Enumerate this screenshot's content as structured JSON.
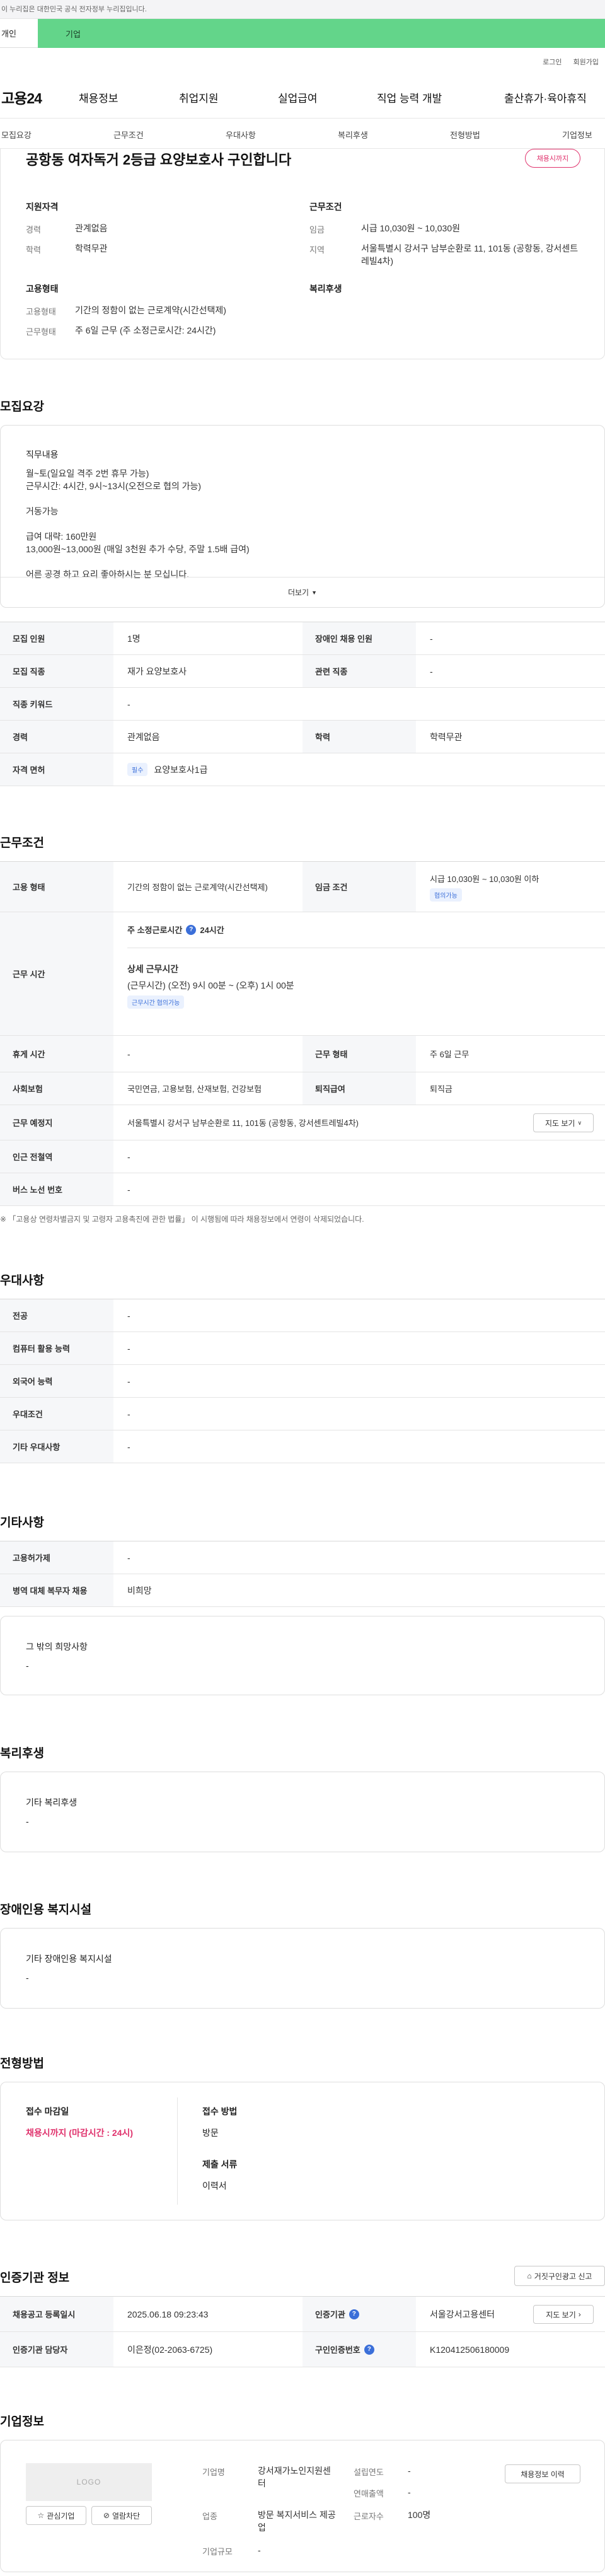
{
  "gov_notice": "이 누리집은 대한민국 공식 전자정부 누리집입니다.",
  "top_tabs": [
    "개인",
    "기업"
  ],
  "util_links": [
    "로그인",
    "회원가입"
  ],
  "logo": "고용24",
  "gnb": [
    "채용정보",
    "취업지원",
    "실업급여",
    "직업 능력 개발",
    "출산휴가·육아휴직"
  ],
  "subnav": [
    "모집요강",
    "근무조건",
    "우대사항",
    "복리후생",
    "전형방법",
    "기업정보"
  ],
  "header": {
    "title": "공항동 여자독거 2등급 요양보호사 구인합니다",
    "badge": "채용시까지",
    "qual_label": "지원자격",
    "career_k": "경력",
    "career_v": "관계없음",
    "edu_k": "학력",
    "edu_v": "학력무관",
    "cond_label": "근무조건",
    "wage_k": "임금",
    "wage_v": "시급 10,030원 ~ 10,030원",
    "region_k": "지역",
    "region_v": "서울특별시 강서구 남부순환로 11, 101동 (공항동, 강서센트레빌4차)",
    "emp_label": "고용형태",
    "emptype_k": "고용형태",
    "emptype_v": "기간의 정함이 없는 근로계약(시간선택제)",
    "worktype_k": "근무형태",
    "worktype_v": "주 6일 근무 (주 소정근로시간: 24시간)",
    "welfare_label": "복리후생"
  },
  "recruit": {
    "title": "모집요강",
    "duty_label": "직무내용",
    "lines": [
      "월~토(일요일 격주 2번 휴무 가능)",
      "근무시간: 4시간, 9시~13시(오전으로 협의 가능)",
      "",
      "거동가능",
      "",
      "급여 대략: 160만원",
      "13,000원~13,000원 (매일 3천원 추가 수당, 주말 1.5배 급여)",
      "",
      "어른 공경 하고 요리 좋아하시는 분 모십니다."
    ],
    "more": "더보기",
    "rows": [
      {
        "k1": "모집 인원",
        "v1": "1명",
        "k2": "장애인 채용 인원",
        "v2": "-"
      },
      {
        "k1": "모집 직종",
        "v1": "재가 요양보호사",
        "k2": "관련 직종",
        "v2": "-"
      },
      {
        "k1": "직종 키워드",
        "v1": "-"
      },
      {
        "k1": "경력",
        "v1": "관계없음",
        "k2": "학력",
        "v2": "학력무관"
      }
    ],
    "license_k": "자격 면허",
    "license_tag": "필수",
    "license_v": "요양보호사1급"
  },
  "work": {
    "title": "근무조건",
    "emptype_k": "고용 형태",
    "emptype_v": "기간의 정함이 없는 근로계약(시간선택제)",
    "wage_k": "임금 조건",
    "wage_v": "시급 10,030원 ~ 10,030원 이하",
    "wage_tag": "협의가능",
    "hours_k": "근무 시간",
    "hours_weekly": "주 소정근로시간",
    "hours_weekly_v": "24시간",
    "hours_detail_label": "상세 근무시간",
    "hours_detail_v": "(근무시간) (오전) 9시 00분 ~ (오후) 1시 00분",
    "hours_tag": "근무시간 협의가능",
    "break_k": "휴게 시간",
    "break_v": "-",
    "form_k": "근무 형태",
    "form_v": "주 6일 근무",
    "ins_k": "사회보험",
    "ins_v": "국민연금, 고용보험, 산재보험, 건강보험",
    "sev_k": "퇴직급여",
    "sev_v": "퇴직금",
    "place_k": "근무 예정지",
    "place_v": "서울특별시 강서구 남부순환로 11, 101동 (공항동, 강서센트레빌4차)",
    "map_btn": "지도 보기",
    "subway_k": "인근 전철역",
    "subway_v": "-",
    "bus_k": "버스 노선 번호",
    "bus_v": "-",
    "note": "※ 「고용상 연령차별금지 및 고령자 고용촉진에 관한 법률」 이 시행됨에 따라 채용정보에서 연령이 삭제되었습니다."
  },
  "pref": {
    "title": "우대사항",
    "rows": [
      {
        "k": "전공",
        "v": "-"
      },
      {
        "k": "컴퓨터 활용 능력",
        "v": "-"
      },
      {
        "k": "외국어 능력",
        "v": "-"
      },
      {
        "k": "우대조건",
        "v": "-"
      },
      {
        "k": "기타 우대사항",
        "v": "-"
      }
    ]
  },
  "etc": {
    "title": "기타사항",
    "rows": [
      {
        "k": "고용허가제",
        "v": "-"
      },
      {
        "k": "병역 대체 복무자 채용",
        "v": "비희망"
      }
    ],
    "other_label": "그 밖의 희망사항",
    "other_v": "-"
  },
  "welfare": {
    "title": "복리후생",
    "label": "기타 복리후생",
    "v": "-"
  },
  "disability": {
    "title": "장애인용 복지시설",
    "label": "기타 장애인용 복지시설",
    "v": "-"
  },
  "process": {
    "title": "전형방법",
    "deadline_label": "접수 마감일",
    "deadline_v": "채용시까지 (마감시간 : 24시)",
    "method_label": "접수 방법",
    "method_v": "방문",
    "docs_label": "제출 서류",
    "docs_v": "이력서"
  },
  "cert": {
    "title": "인증기관 정보",
    "report_btn": "거짓구인광고 신고",
    "date_k": "채용공고 등록일시",
    "date_v": "2025.06.18 09:23:43",
    "org_k": "인증기관",
    "org_v": "서울강서고용센터",
    "map_btn": "지도 보기",
    "mgr_k": "인증기관 담당자",
    "mgr_v": "이은정(02-2063-6725)",
    "no_k": "구인인증번호",
    "no_v": "K120412506180009"
  },
  "company": {
    "title": "기업정보",
    "logo_text": "LOGO",
    "interest_btn": "관심기업",
    "block_btn": "열람차단",
    "name_k": "기업명",
    "name_v": "강서재가노인지원센터",
    "ind_k": "업종",
    "ind_v": "방문 복지서비스 제공업",
    "size_k": "기업규모",
    "size_v": "-",
    "year_k": "설립연도",
    "year_v": "-",
    "sales_k": "연매출액",
    "sales_v": "-",
    "emp_k": "근로자수",
    "emp_v": "100명",
    "jobs_btn": "채용정보 이력"
  }
}
